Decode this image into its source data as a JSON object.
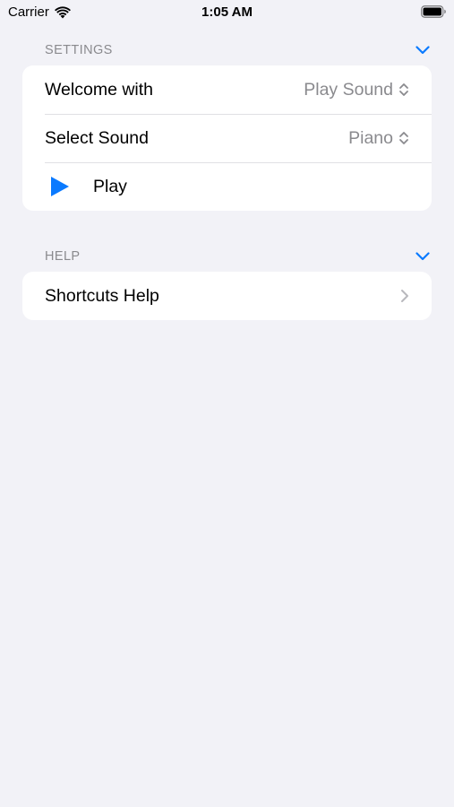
{
  "status_bar": {
    "carrier": "Carrier",
    "time": "1:05 AM",
    "icons": [
      "wifi-icon",
      "battery-icon"
    ]
  },
  "settings": {
    "header": "SETTINGS",
    "rows": [
      {
        "label": "Welcome with",
        "value": "Play Sound",
        "icon": "up-down-chevron-icon"
      },
      {
        "label": "Select Sound",
        "value": "Piano",
        "icon": "up-down-chevron-icon"
      },
      {
        "label": "Play",
        "icon": "play-icon"
      }
    ]
  },
  "help": {
    "header": "HELP",
    "rows": [
      {
        "label": "Shortcuts Help",
        "icon": "chevron-right-icon"
      }
    ]
  },
  "colors": {
    "accent": "#0a7aff",
    "background": "#f2f2f7",
    "secondary_text": "#8a8a8e"
  }
}
